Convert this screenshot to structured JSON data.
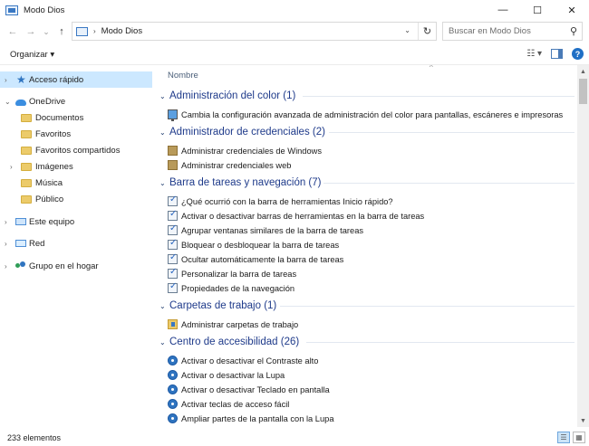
{
  "window": {
    "title": "Modo Dios",
    "minimize_glyph": "—",
    "maximize_glyph": "☐",
    "close_glyph": "✕"
  },
  "nav": {
    "back_glyph": "←",
    "forward_glyph": "→",
    "recent_glyph": "⌄",
    "up_glyph": "↑"
  },
  "address": {
    "separator": "›",
    "crumb": "Modo Dios",
    "dropdown_glyph": "⌄",
    "refresh_glyph": "↻"
  },
  "search": {
    "placeholder": "Buscar en Modo Dios",
    "icon_glyph": "⚲"
  },
  "command_bar": {
    "organize_label": "Organizar ▾",
    "view_options_glyph": "☷ ▾",
    "help_glyph": "?"
  },
  "sidebar": {
    "quick_access": "Acceso rápido",
    "onedrive": "OneDrive",
    "onedrive_items": [
      "Documentos",
      "Favoritos",
      "Favoritos compartidos",
      "Imágenes",
      "Música",
      "Público"
    ],
    "this_pc": "Este equipo",
    "network": "Red",
    "homegroup": "Grupo en el hogar"
  },
  "content": {
    "column_header": "Nombre",
    "sort_glyph": "^",
    "groups": [
      {
        "title": "Administración del color (1)",
        "items": [
          "Cambia la configuración avanzada de administración del color para pantallas, escáneres e impresoras"
        ]
      },
      {
        "title": "Administrador de credenciales (2)",
        "items": [
          "Administrar credenciales de Windows",
          "Administrar credenciales web"
        ]
      },
      {
        "title": "Barra de tareas y navegación (7)",
        "items": [
          "¿Qué ocurrió con la barra de herramientas Inicio rápido?",
          "Activar o desactivar barras de herramientas en la barra de tareas",
          "Agrupar ventanas similares de la barra de tareas",
          "Bloquear o desbloquear la barra de tareas",
          "Ocultar automáticamente la barra de tareas",
          "Personalizar la barra de tareas",
          "Propiedades de la navegación"
        ]
      },
      {
        "title": "Carpetas de trabajo (1)",
        "items": [
          "Administrar carpetas de trabajo"
        ]
      },
      {
        "title": "Centro de accesibilidad (26)",
        "items": [
          "Activar o desactivar el Contraste alto",
          "Activar o desactivar la Lupa",
          "Activar o desactivar Teclado en pantalla",
          "Activar teclas de acceso fácil",
          "Ampliar partes de la pantalla con la Lupa"
        ]
      }
    ]
  },
  "scrollbar": {
    "up_glyph": "▲",
    "down_glyph": "▼"
  },
  "status_bar": {
    "item_count": "233 elementos",
    "details_glyph": "☰",
    "tiles_glyph": "▦"
  },
  "colors": {
    "selection": "#cce8ff",
    "group_title": "#1e3a8a",
    "accent": "#1f6fc5"
  }
}
